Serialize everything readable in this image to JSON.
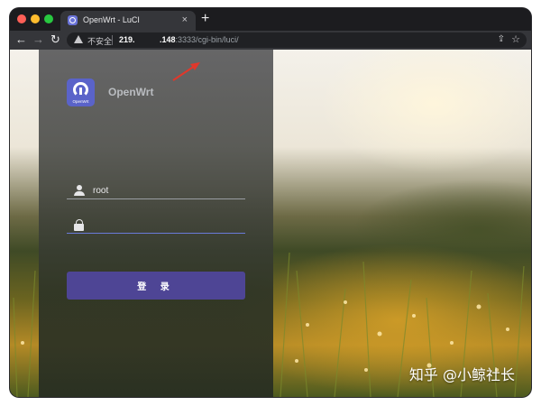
{
  "browser": {
    "tab_title": "OpenWrt - LuCI",
    "tab_close": "×",
    "new_tab": "+",
    "back": "←",
    "forward": "→",
    "reload": "↻",
    "security_label": "不安全",
    "url_host": "219.",
    "url_port_part": ".148",
    "url_rest": ":3333/cgi-bin/luci/",
    "share": "⇪",
    "bookmark": "☆"
  },
  "login": {
    "logo_caption": "OpenWrt",
    "brand_name": "OpenWrt",
    "username_value": "root",
    "password_value": "",
    "login_button": "登 录"
  },
  "watermark": "知乎 @小鲸社长",
  "colors": {
    "accent": "#4e4595",
    "logo_bg": "#5a63c9",
    "annotation_arrow": "#e0382b"
  }
}
